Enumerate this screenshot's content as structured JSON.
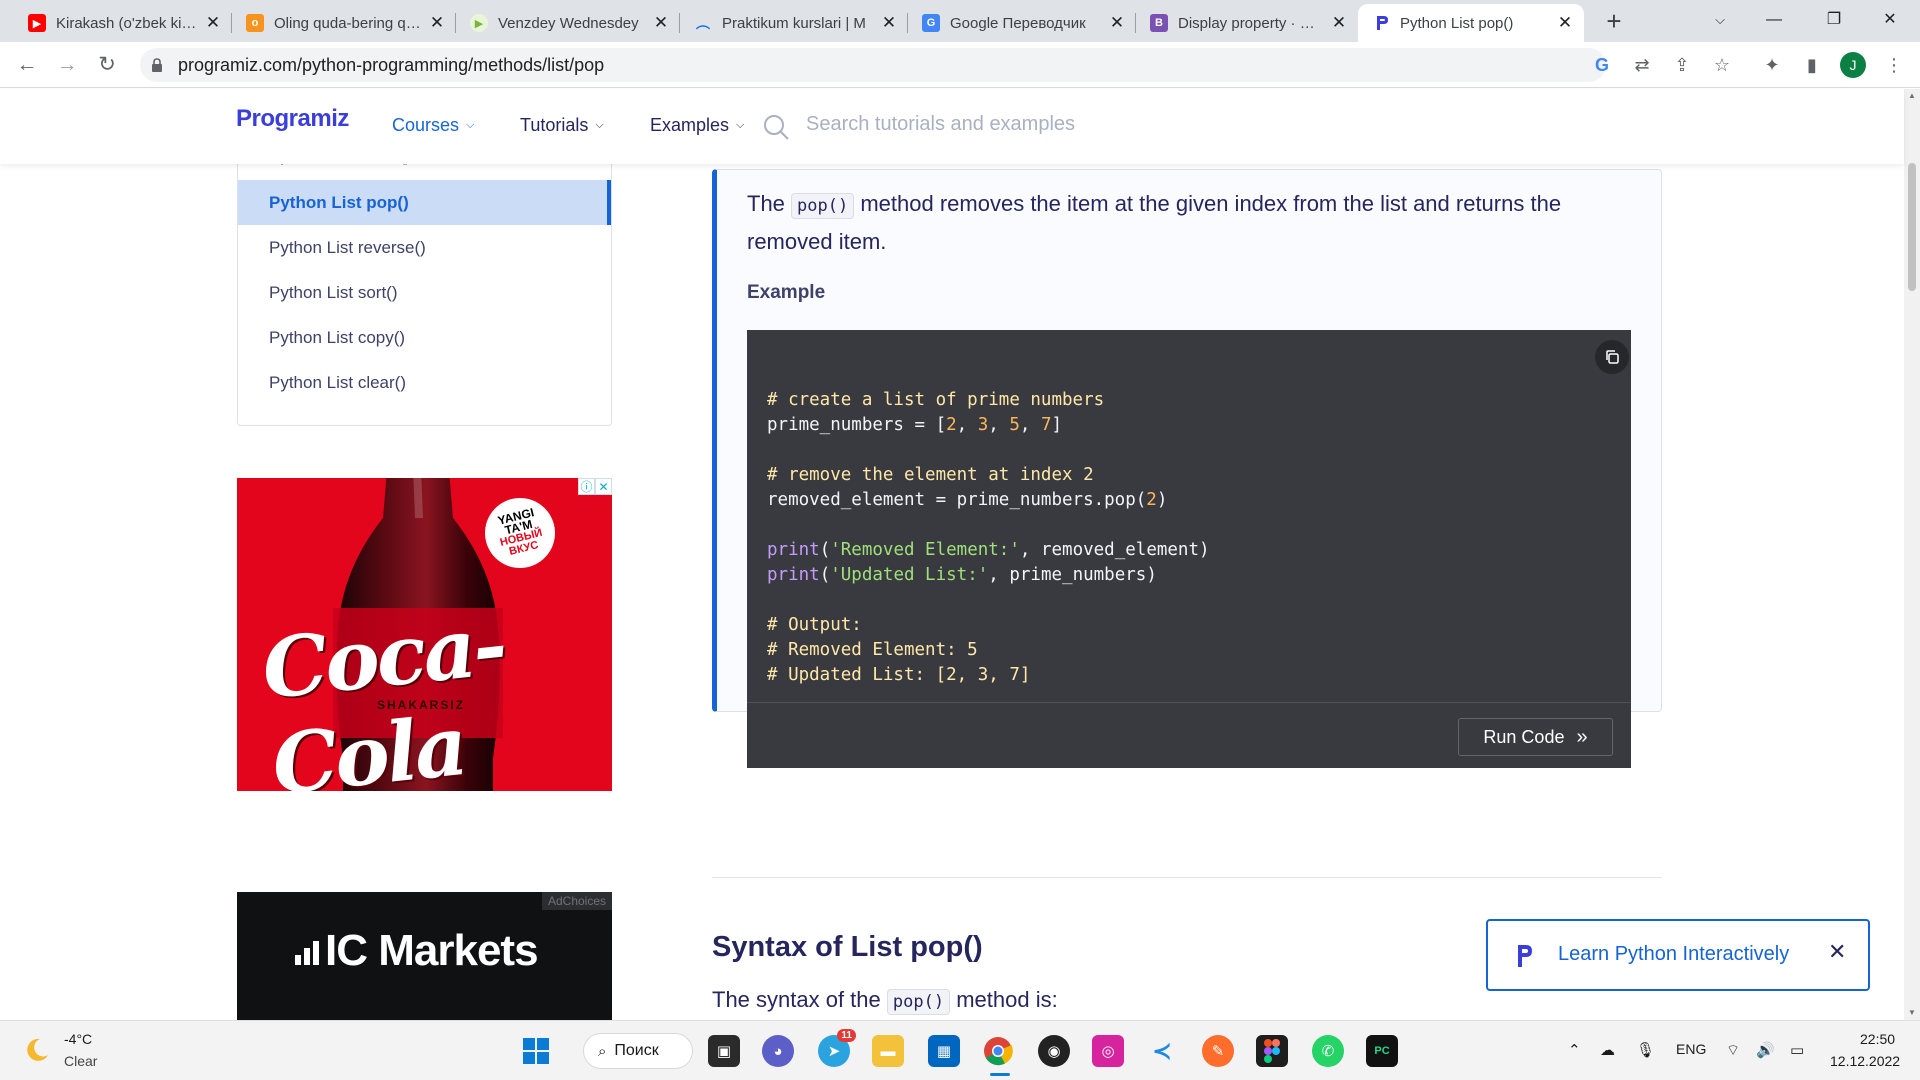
{
  "browser": {
    "tabs": [
      {
        "title": "Kirakash (o'zbek kino)",
        "favicon": "youtube-icon",
        "color": "#ff0000"
      },
      {
        "title": "Oling quda-bering quda",
        "favicon": "odnoklassniki-icon",
        "color": "#f7931e"
      },
      {
        "title": "Venzdey Wednesdey",
        "favicon": "play-icon",
        "color": "#7cb342"
      },
      {
        "title": "Praktikum kurslari | M",
        "favicon": "praktikum-icon",
        "color": "#1a73e8"
      },
      {
        "title": "Google Переводчик",
        "favicon": "google-translate-icon",
        "color": "#4285f4"
      },
      {
        "title": "Display property · Boo",
        "favicon": "bootstrap-icon",
        "color": "#7952b3"
      },
      {
        "title": "Python List pop()",
        "favicon": "programiz-icon",
        "color": "#3b3ed8",
        "active": true
      }
    ],
    "url": "programiz.com/python-programming/methods/list/pop",
    "profile_initial": "J"
  },
  "header": {
    "logo": "Programiz",
    "nav": [
      "Courses",
      "Tutorials",
      "Examples"
    ],
    "search_placeholder": "Search tutorials and examples"
  },
  "sidebar": {
    "items": [
      "Python List count()",
      "Python List pop()",
      "Python List reverse()",
      "Python List sort()",
      "Python List copy()",
      "Python List clear()"
    ],
    "active_index": 1
  },
  "ads": {
    "coke_brand": "Coca-Cola",
    "coke_badge_1": "YANGI TA'M",
    "coke_badge_2": "НОВЫЙ ВКУС",
    "coke_sub": "SHAKARSIZ",
    "ic_brand": "IC Markets",
    "adchoices": "AdChoices"
  },
  "content": {
    "intro_before": "The",
    "intro_code": "pop()",
    "intro_after": "method removes the item at the given index from the list and returns the removed item.",
    "example_label": "Example",
    "code_lines": [
      "# create a list of prime numbers",
      "prime_numbers = [2, 3, 5, 7]",
      "",
      "# remove the element at index 2",
      "removed_element = prime_numbers.pop(2)",
      "",
      "print('Removed Element:', removed_element)",
      "print('Updated List:', prime_numbers)",
      "",
      "# Output:",
      "# Removed Element: 5",
      "# Updated List: [2, 3, 7]"
    ],
    "run_button": "Run Code",
    "syntax_heading": "Syntax of List pop()",
    "syntax_before": "The syntax of the",
    "syntax_code": "pop()",
    "syntax_after": "method is:"
  },
  "promo": {
    "label": "Learn Python Interactively"
  },
  "taskbar": {
    "temperature": "-4°C",
    "weather": "Clear",
    "search_label": "Поиск",
    "telegram_badge": "11",
    "language": "ENG",
    "time": "22:50",
    "date": "12.12.2022"
  }
}
